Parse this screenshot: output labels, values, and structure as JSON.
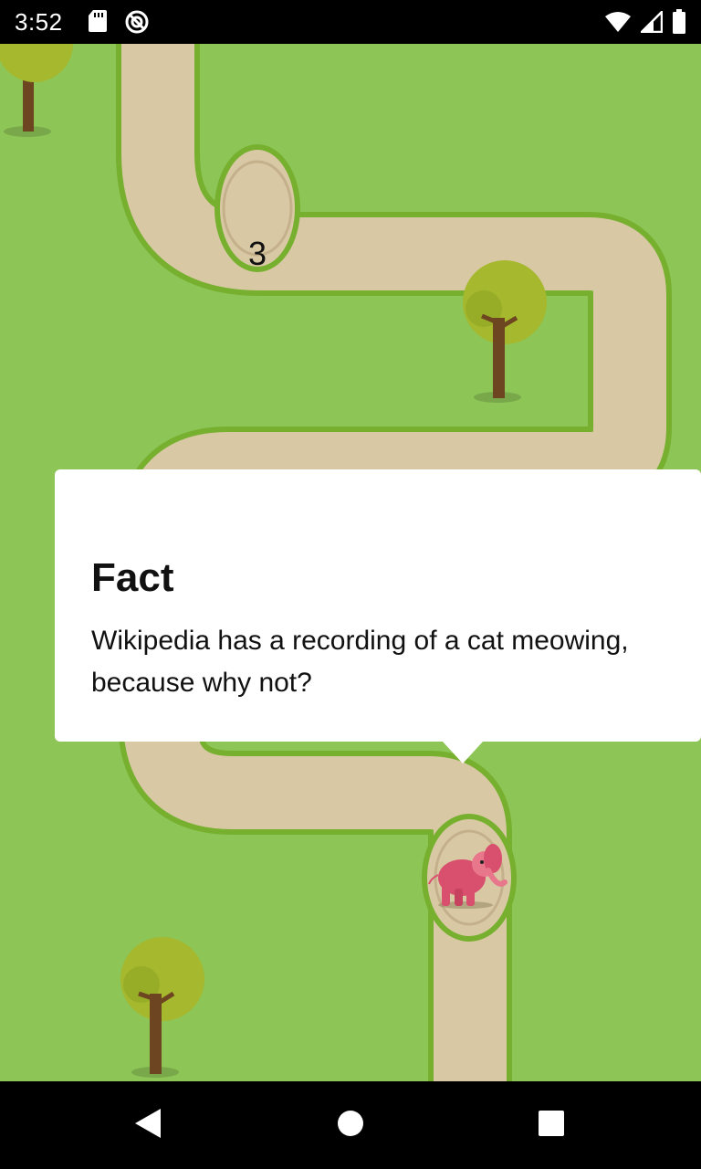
{
  "status_bar": {
    "time": "3:52",
    "icons": [
      "sd-card-icon",
      "sync-disabled-icon",
      "wifi-icon",
      "signal-icon",
      "battery-icon"
    ]
  },
  "map": {
    "current_level_label": "3",
    "colors": {
      "grass": "#8dc556",
      "path": "#d8c9a4",
      "path_border": "#77b02f",
      "tree_leaves": "#a5b82e",
      "tree_trunk": "#6d4520",
      "elephant": "#d9506e"
    }
  },
  "fact_popup": {
    "title": "Fact",
    "text_line1": "Wikipedia has a recording of a cat meowing,",
    "text_line2": "because why not?"
  },
  "nav_bar": {
    "buttons": [
      "back-icon",
      "home-icon",
      "recents-icon"
    ]
  }
}
